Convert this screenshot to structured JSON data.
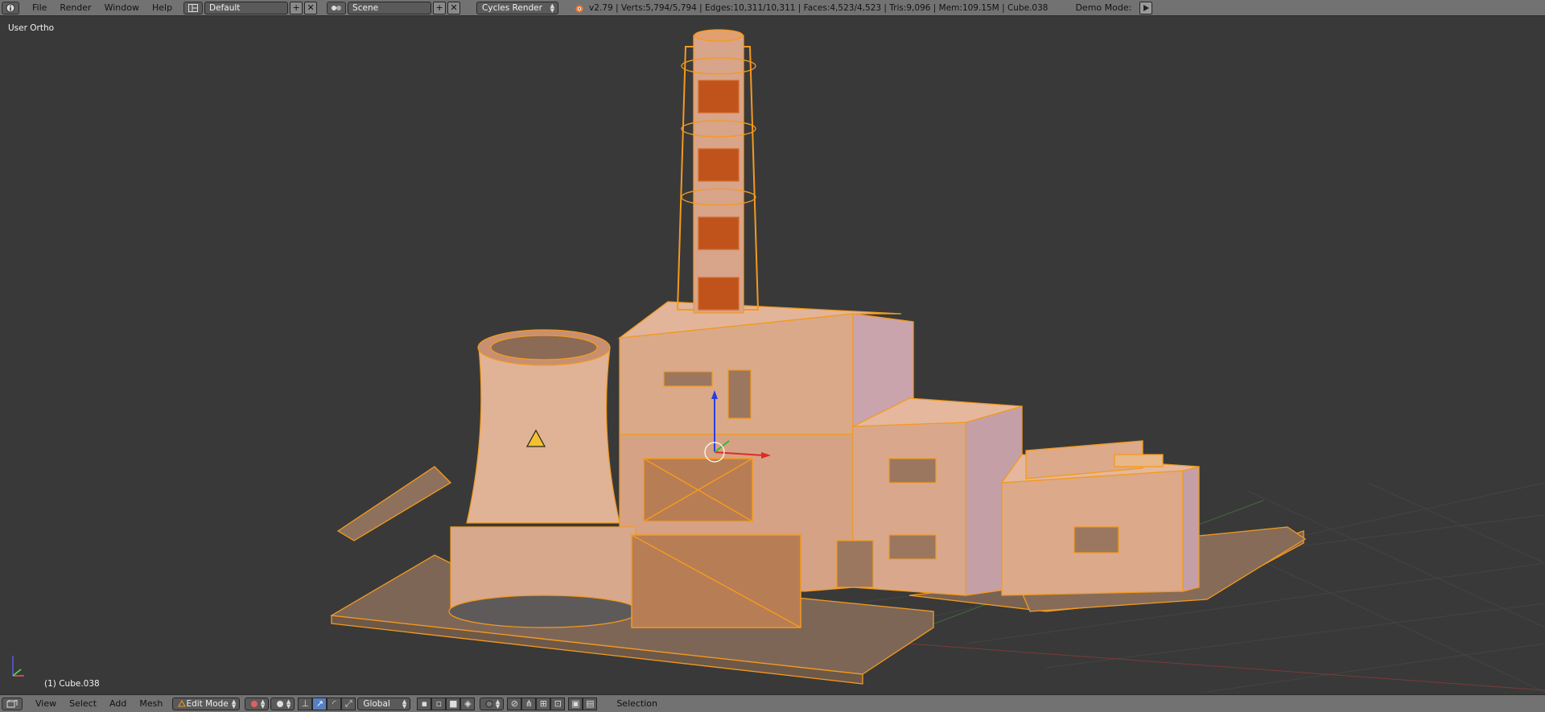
{
  "topbar": {
    "menus": [
      "File",
      "Render",
      "Window",
      "Help"
    ],
    "screen_layout": "Default",
    "scene": "Scene",
    "render_engine": "Cycles Render",
    "stats": "v2.79 | Verts:5,794/5,794 | Edges:10,311/10,311 | Faces:4,523/4,523 | Tris:9,096 | Mem:109.15M | Cube.038",
    "demo_mode_label": "Demo Mode:"
  },
  "viewport": {
    "view_name": "User Ortho",
    "object_info": "(1) Cube.038"
  },
  "bottombar": {
    "menus": [
      "View",
      "Select",
      "Add",
      "Mesh"
    ],
    "mode": "Edit Mode",
    "orientation": "Global",
    "selection_label": "Selection"
  },
  "colors": {
    "header_bg": "#727272",
    "viewport_bg": "#393939",
    "selection_orange": "#f39a1f",
    "active_blue": "#5680c2"
  },
  "icons": [
    "info-icon",
    "screen-layout-icon",
    "scene-icon",
    "blender-logo-icon",
    "play-icon",
    "view3d-icon",
    "edit-mode-icon",
    "pivot-icon",
    "manipulator-icon",
    "viewport-shading-icon",
    "proportional-edit-icon",
    "snap-icon",
    "render-icon"
  ]
}
